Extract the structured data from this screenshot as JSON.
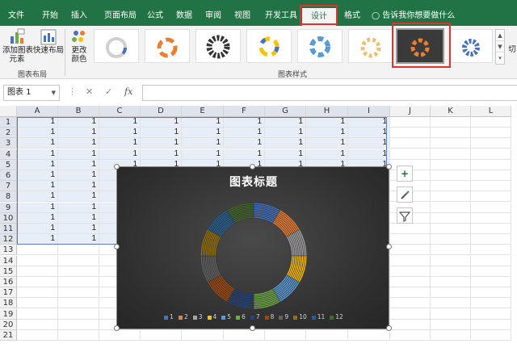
{
  "ribbon_tabs": [
    "文件",
    "开始",
    "插入",
    "页面布局",
    "公式",
    "数据",
    "审阅",
    "视图",
    "开发工具",
    "设计",
    "格式"
  ],
  "active_tab": "设计",
  "tell_me": "告诉我你想要做什么",
  "ribbon": {
    "add_element_label": "添加图表\n元素",
    "quick_layout_label": "快速布局",
    "change_colors_label": "更改\n颜色",
    "group_layout": "图表布局",
    "group_styles": "图表样式",
    "next_group_cut": "切"
  },
  "formula_bar": {
    "name_box": "图表 1",
    "cancel": "✕",
    "enter": "✓",
    "fx": "fx",
    "content": ""
  },
  "columns": [
    "A",
    "B",
    "C",
    "D",
    "E",
    "F",
    "G",
    "H",
    "I",
    "J",
    "K",
    "L"
  ],
  "rows": [
    "1",
    "2",
    "3",
    "4",
    "5",
    "6",
    "7",
    "8",
    "9",
    "10",
    "11",
    "12",
    "13",
    "14",
    "15",
    "16",
    "17",
    "18",
    "19",
    "20",
    "21"
  ],
  "cell_value": "1",
  "chart": {
    "title": "图表标题",
    "colors": {
      "background": "#333333",
      "series": [
        "#4472c4",
        "#ed7d31",
        "#a5a5a5",
        "#ffc000",
        "#5b9bd5",
        "#70ad47",
        "#264478",
        "#9e480e",
        "#636363",
        "#997300",
        "#255e91",
        "#43682b"
      ]
    }
  },
  "chart_data": {
    "type": "doughnut",
    "title": "图表标题",
    "categories": [
      "1",
      "2",
      "3",
      "4",
      "5",
      "6",
      "7",
      "8",
      "9",
      "10",
      "11",
      "12"
    ],
    "series": [
      {
        "values": [
          1,
          1,
          1,
          1,
          1,
          1,
          1,
          1,
          1,
          1,
          1,
          1
        ]
      },
      {
        "values": [
          1,
          1,
          1,
          1,
          1,
          1,
          1,
          1,
          1,
          1,
          1,
          1
        ]
      },
      {
        "values": [
          1,
          1,
          1,
          1,
          1,
          1,
          1,
          1,
          1,
          1,
          1,
          1
        ]
      },
      {
        "values": [
          1,
          1,
          1,
          1,
          1,
          1,
          1,
          1,
          1,
          1,
          1,
          1
        ]
      },
      {
        "values": [
          1,
          1,
          1,
          1,
          1,
          1,
          1,
          1,
          1,
          1,
          1,
          1
        ]
      },
      {
        "values": [
          1,
          1,
          1,
          1,
          1,
          1,
          1,
          1,
          1,
          1,
          1,
          1
        ]
      },
      {
        "values": [
          1,
          1,
          1,
          1,
          1,
          1,
          1,
          1,
          1,
          1,
          1,
          1
        ]
      },
      {
        "values": [
          1,
          1,
          1,
          1,
          1,
          1,
          1,
          1,
          1,
          1,
          1,
          1
        ]
      },
      {
        "values": [
          1,
          1,
          1,
          1,
          1,
          1,
          1,
          1,
          1,
          1,
          1,
          1
        ]
      }
    ],
    "legend": [
      "1",
      "2",
      "3",
      "4",
      "5",
      "6",
      "7",
      "8",
      "9",
      "10",
      "11",
      "12"
    ],
    "legend_position": "bottom"
  },
  "side_buttons": [
    "chart-elements-plus-icon",
    "chart-styles-brush-icon",
    "chart-filters-funnel-icon"
  ]
}
